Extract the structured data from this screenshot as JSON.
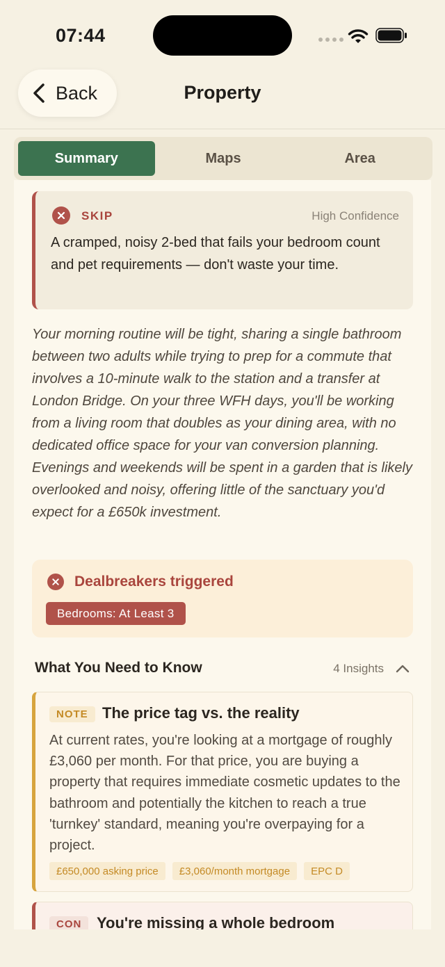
{
  "status_bar": {
    "time": "07:44"
  },
  "nav": {
    "back_label": "Back",
    "title": "Property"
  },
  "tabs": [
    {
      "label": "Summary",
      "active": true
    },
    {
      "label": "Maps",
      "active": false
    },
    {
      "label": "Area",
      "active": false
    }
  ],
  "verdict": {
    "label": "SKIP",
    "confidence": "High Confidence",
    "text": "A cramped, noisy 2-bed that fails your bedroom count and pet requirements — don't waste your time."
  },
  "narrative": "Your morning routine will be tight, sharing a single bathroom between two adults while trying to prep for a commute that involves a 10-minute walk to the station and a transfer at London Bridge. On your three WFH days, you'll be working from a living room that doubles as your dining area, with no dedicated office space for your van conversion planning. Evenings and weekends will be spent in a garden that is likely overlooked and noisy, offering little of the sanctuary you'd expect for a £650k investment.",
  "dealbreakers": {
    "title": "Dealbreakers triggered",
    "items": [
      "Bedrooms: At Least 3"
    ]
  },
  "insights_section": {
    "title": "What You Need to Know",
    "count_label": "4 Insights",
    "items": [
      {
        "tag": "NOTE",
        "title": "The price tag vs. the reality",
        "body": "At current rates, you're looking at a mortgage of roughly £3,060 per month. For that price, you are buying a property that requires immediate cosmetic updates to the bathroom and potentially the kitchen to reach a true 'turnkey' standard, meaning you're overpaying for a project.",
        "chips": [
          "£650,000 asking price",
          "£3,060/month mortgage",
          "EPC D"
        ]
      },
      {
        "tag": "CON",
        "title": "You're missing a whole bedroom"
      }
    ]
  },
  "colors": {
    "background": "#f6f1e3",
    "accent_green": "#3c7350",
    "danger_red": "#b0524a",
    "note_amber": "#d7a43e"
  }
}
